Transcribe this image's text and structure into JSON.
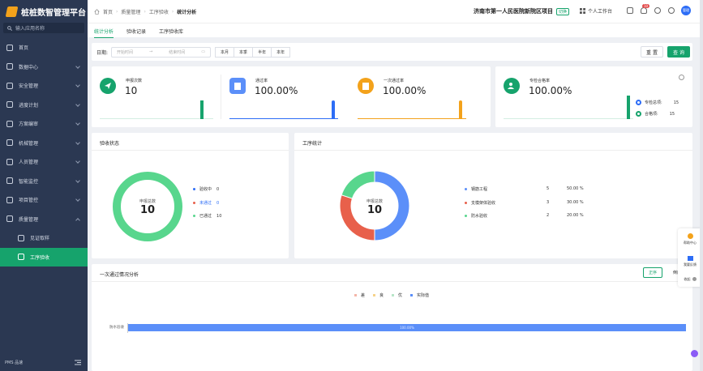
{
  "app": {
    "title": "桩桩数智管理平台",
    "search_placeholder": "输入应用名称",
    "footer_brand": "PMS 品速"
  },
  "sidebar": {
    "items": [
      {
        "label": "首页",
        "expand": false
      },
      {
        "label": "数据中心",
        "expand": true
      },
      {
        "label": "安全管理",
        "expand": true
      },
      {
        "label": "进度计划",
        "expand": true
      },
      {
        "label": "方案编审",
        "expand": true
      },
      {
        "label": "机械管理",
        "expand": true
      },
      {
        "label": "人员管理",
        "expand": true
      },
      {
        "label": "智能监控",
        "expand": true
      },
      {
        "label": "项目管控",
        "expand": true
      },
      {
        "label": "质量管理",
        "expand": true,
        "open": true
      },
      {
        "label": "见证取样",
        "sub": true
      },
      {
        "label": "工序验收",
        "sub": true,
        "active": true
      }
    ]
  },
  "header": {
    "breadcrumb": [
      "首页",
      "质量管理",
      "工序验收",
      "统计分析"
    ],
    "project": "济南市第一人民医院新院区项目",
    "project_tag": "切换",
    "workbench": "个人工作台",
    "notification_count": "10",
    "avatar": "管理"
  },
  "tabs": [
    "统计分析",
    "验收记录",
    "工序验收库"
  ],
  "filter": {
    "date_label": "日期:",
    "start_placeholder": "开始时间",
    "end_placeholder": "结束时间",
    "ranges": [
      "本月",
      "本季",
      "半年",
      "本年"
    ],
    "reset": "重 置",
    "query": "查 询"
  },
  "stats": [
    {
      "label": "申报次数",
      "value": "10",
      "color": "#16a36c"
    },
    {
      "label": "通过率",
      "value": "100.00%",
      "color": "#2d6df6"
    },
    {
      "label": "一次通过率",
      "value": "100.00%",
      "color": "#f3a21b"
    },
    {
      "label": "专检合格率",
      "value": "100.00%",
      "color": "#16a36c"
    }
  ],
  "special_check": {
    "total_label": "专检总项:",
    "total": "15",
    "pass_label": "合格项:",
    "pass": "15"
  },
  "acceptance_status": {
    "title": "验收状态",
    "center_label": "申报总数",
    "center_value": "10",
    "legend": [
      {
        "label": "验收中",
        "value": "0",
        "color": "#2d6df6"
      },
      {
        "label": "未通过",
        "value": "0",
        "color": "#e8604b"
      },
      {
        "label": "已通过",
        "value": "10",
        "color": "#58d68d"
      }
    ]
  },
  "process_stats": {
    "title": "工序统计",
    "center_label": "申报总数",
    "center_value": "10",
    "legend": [
      {
        "label": "钢筋工程",
        "count": "5",
        "pct": "50.00 %",
        "color": "#5b8ff9"
      },
      {
        "label": "支模架体验收",
        "count": "3",
        "pct": "30.00 %",
        "color": "#e8604b"
      },
      {
        "label": "防水验收",
        "count": "2",
        "pct": "20.00 %",
        "color": "#58d68d"
      }
    ]
  },
  "first_pass": {
    "title": "一次通过情况分析",
    "sort_asc": "正序",
    "sort_desc": "倒序",
    "legend": [
      {
        "label": "差",
        "color": "#f4b6a9"
      },
      {
        "label": "良",
        "color": "#f6d38a"
      },
      {
        "label": "优",
        "color": "#b8e6c8"
      },
      {
        "label": "实际值",
        "color": "#5b8ff9"
      }
    ],
    "row_label": "防水验收",
    "bar_label": "100.00%",
    "bar_value": 100
  },
  "float_panel": {
    "help": "帮助中心",
    "feedback": "我要反馈",
    "collapse": "收起"
  },
  "chart_data": [
    {
      "type": "pie",
      "title": "验收状态",
      "categories": [
        "验收中",
        "未通过",
        "已通过"
      ],
      "values": [
        0,
        0,
        10
      ]
    },
    {
      "type": "pie",
      "title": "工序统计",
      "categories": [
        "钢筋工程",
        "支模架体验收",
        "防水验收"
      ],
      "values": [
        5,
        3,
        2
      ]
    },
    {
      "type": "bar",
      "title": "一次通过情况分析",
      "categories": [
        "防水验收"
      ],
      "values": [
        100
      ]
    }
  ]
}
